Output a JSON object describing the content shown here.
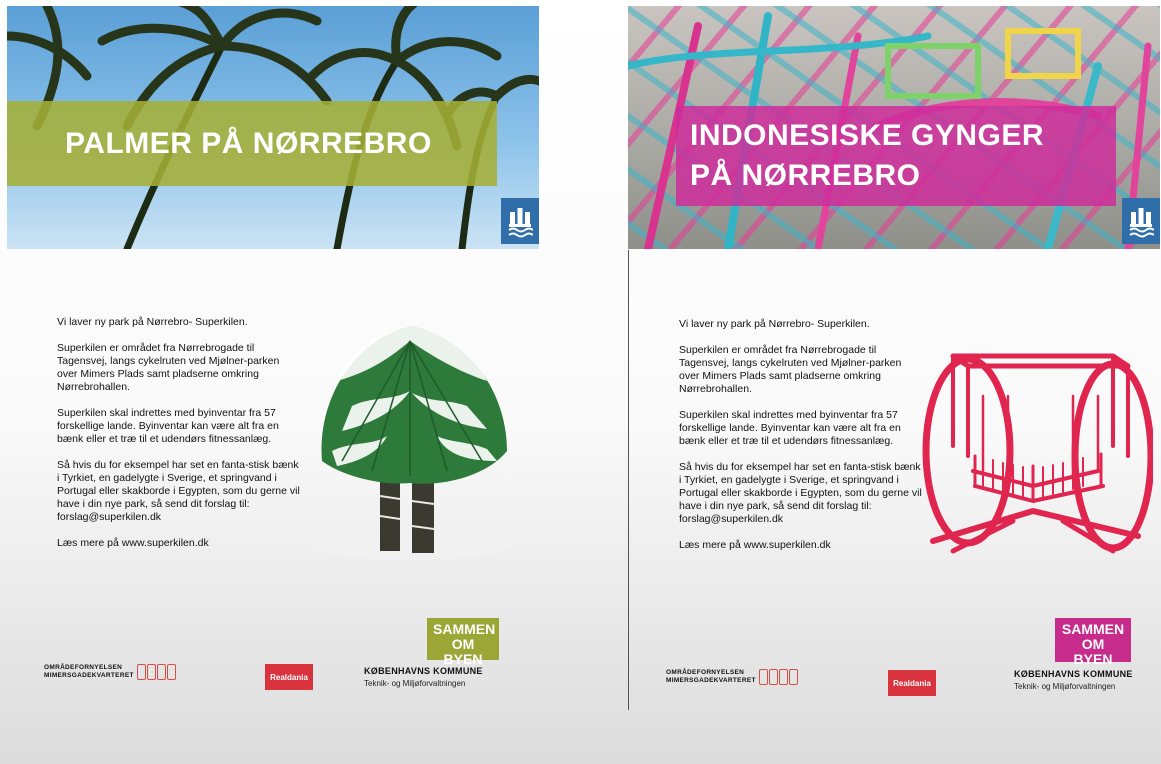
{
  "posters": [
    {
      "title_lines": [
        "PALMER PÅ NØRREBRO"
      ],
      "accent_color": "#a5af37",
      "paragraphs": [
        "Vi laver ny park på Nørrebro- Superkilen.",
        "Superkilen er området fra Nørrebrogade til Tagensvej, langs cykelruten ved Mjølner-parken over Mimers Plads samt pladserne omkring Nørrebrohallen.",
        "Superkilen skal indrettes med byinventar fra 57 forskellige lande. Byinventar kan være alt fra en bænk eller et træ til et udendørs fitnessanlæg.",
        "Så hvis du for eksempel har set en fanta-stisk bænk i Tyrkiet, en gadelygte i Sverige, et springvand i Portugal eller skakborde i Egypten, som du gerne vil have i din nye park, så send dit forslag til: forslag@superkilen.dk",
        "Læs mere på www.superkilen.dk"
      ],
      "illustration": "snow-covered-palm",
      "footer": {
        "sammen_line1": "SAMMEN",
        "sammen_line2": "OM BYEN",
        "kommune": "KØBENHAVNS KOMMUNE",
        "forvaltning": "Teknik- og Miljøforvaltningen",
        "omr_line1": "OMRÅDEFORNYELSEN",
        "omr_line2": "MIMERSGADEKVARTERET",
        "realdania": "Realdania"
      }
    },
    {
      "title_lines": [
        "INDONESISKE GYNGER",
        "PÅ NØRREBRO"
      ],
      "accent_color": "#cd2d9b",
      "paragraphs": [
        "Vi laver ny park på Nørrebro- Superkilen.",
        "Superkilen er området fra Nørrebrogade til Tagensvej, langs cykelruten ved Mjølner-parken over Mimers Plads samt pladserne omkring Nørrebrohallen.",
        "Superkilen skal indrettes med byinventar fra 57 forskellige lande. Byinventar kan være alt fra en bænk eller et træ til et udendørs fitnessanlæg.",
        "Så hvis du for eksempel har set en fanta-stisk bænk i Tyrkiet, en gadelygte i Sverige, et springvand i Portugal eller skakborde i Egypten, som du gerne vil have i din nye park, så send dit forslag til: forslag@superkilen.dk",
        "Læs mere på www.superkilen.dk"
      ],
      "illustration": "red-swing",
      "footer": {
        "sammen_line1": "SAMMEN",
        "sammen_line2": "OM BYEN",
        "kommune": "KØBENHAVNS KOMMUNE",
        "forvaltning": "Teknik- og Miljøforvaltningen",
        "omr_line1": "OMRÅDEFORNYELSEN",
        "omr_line2": "MIMERSGADEKVARTERET",
        "realdania": "Realdania"
      }
    }
  ]
}
